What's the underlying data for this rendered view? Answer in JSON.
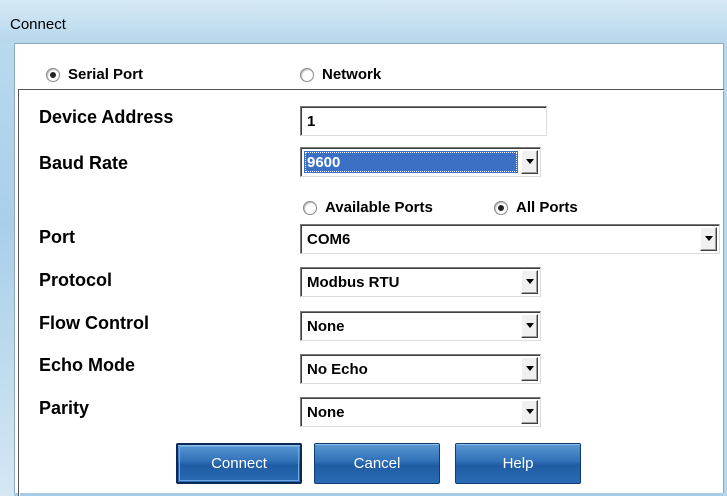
{
  "window": {
    "title": "Connect"
  },
  "connection_type": {
    "serial_label": "Serial Port",
    "serial_checked": true,
    "network_label": "Network",
    "network_checked": false
  },
  "fields": {
    "device_address": {
      "label": "Device Address",
      "value": "1"
    },
    "baud_rate": {
      "label": "Baud Rate",
      "value": "9600"
    },
    "port_filter": {
      "available_label": "Available Ports",
      "available_checked": false,
      "all_label": "All Ports",
      "all_checked": true
    },
    "port": {
      "label": "Port",
      "value": "COM6"
    },
    "protocol": {
      "label": "Protocol",
      "value": "Modbus RTU"
    },
    "flow_control": {
      "label": "Flow Control",
      "value": "None"
    },
    "echo_mode": {
      "label": "Echo Mode",
      "value": "No Echo"
    },
    "parity": {
      "label": "Parity",
      "value": "None"
    }
  },
  "buttons": {
    "connect": "Connect",
    "cancel": "Cancel",
    "help": "Help"
  },
  "colors": {
    "button_blue": "#2f6fb6",
    "selection_blue": "#3a6fc4",
    "titlebar": "#c2def0"
  }
}
